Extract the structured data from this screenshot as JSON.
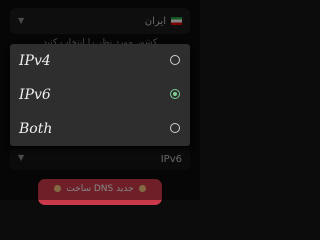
{
  "background": {
    "country_label": "ایران",
    "hint_text": "کشور مورد نظر را انتخاب کنید",
    "ip_version_value": "IPv6",
    "action_button_label": "ساخت DNS جدید"
  },
  "dialog": {
    "options": [
      {
        "label": "IPv4",
        "selected": false
      },
      {
        "label": "IPv6",
        "selected": true
      },
      {
        "label": "Both",
        "selected": false
      }
    ]
  },
  "colors": {
    "background": "#0c0c0c",
    "dialog": "#2e2e2e",
    "accent_radio": "#7ccf96",
    "action_button": "#c83a49"
  },
  "icons": {
    "flag": "iran-flag-icon",
    "dropdown": "chevron-down-icon",
    "radio_selected": "radio-checked-icon",
    "radio_unselected": "radio-unchecked-icon"
  }
}
